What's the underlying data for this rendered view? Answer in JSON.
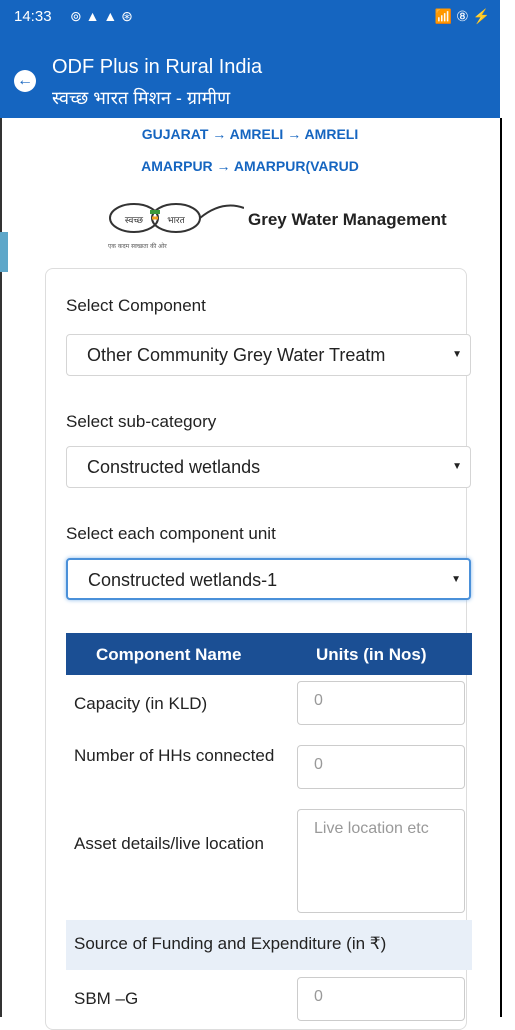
{
  "status_bar": {
    "time": "14:33",
    "icons": "⊚ ▲ ▲ ⊛",
    "right": "📶 ⑧ ⚡"
  },
  "app_bar": {
    "title": "ODF Plus in Rural India",
    "subtitle": "स्वच्छ भारत मिशन - ग्रामीण"
  },
  "breadcrumb": {
    "line1": "GUJARAT → AMRELI → AMRELI",
    "line2": "AMARPUR → AMARPUR(VARUD"
  },
  "header": {
    "logo_text": "स्वच्छ भारत",
    "section_title": "Grey Water Management"
  },
  "form": {
    "component_label": "Select Component",
    "component_value": "Other Community Grey Water Treatm",
    "subcategory_label": "Select sub-category",
    "subcategory_value": "Constructed wetlands",
    "unit_label": "Select each component unit",
    "unit_value": "Constructed wetlands-1"
  },
  "table": {
    "col1": "Component Name",
    "col2": "Units (in Nos)",
    "rows": [
      {
        "label": "Capacity (in KLD)",
        "placeholder": "0"
      },
      {
        "label": "Number of HHs connected",
        "placeholder": "0"
      },
      {
        "label": "Asset details/live location",
        "placeholder": "Live location etc"
      }
    ]
  },
  "funding": {
    "title": "Source of Funding and Expenditure (in ₹)",
    "sbm_label": "SBM –G",
    "sbm_placeholder": "0"
  }
}
